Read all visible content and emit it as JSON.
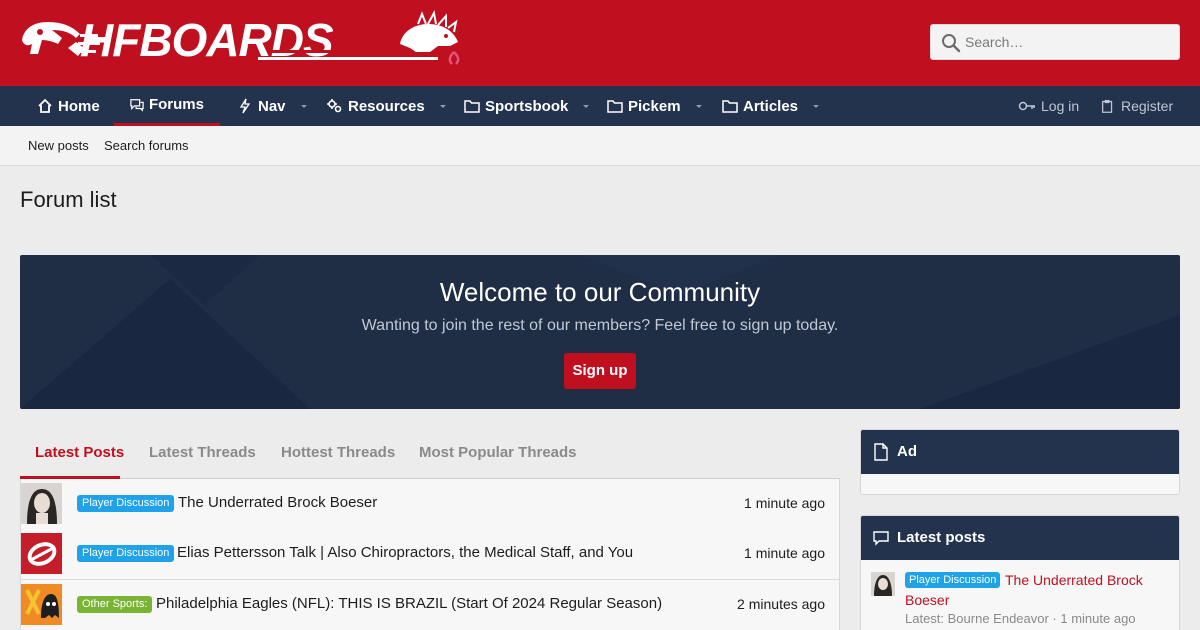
{
  "header": {
    "logo_text": "HFBOARDS",
    "search_placeholder": "Search…"
  },
  "nav": {
    "items": [
      {
        "label": "Home",
        "icon": "home-icon"
      },
      {
        "label": "Forums",
        "icon": "comments-icon",
        "active": true
      },
      {
        "label": "Nav",
        "icon": "bolt-icon",
        "has_dropdown": true
      },
      {
        "label": "Resources",
        "icon": "cogs-icon",
        "has_dropdown": true
      },
      {
        "label": "Sportsbook",
        "icon": "folder-icon",
        "has_dropdown": true
      },
      {
        "label": "Pickem",
        "icon": "folder-icon",
        "has_dropdown": true
      },
      {
        "label": "Articles",
        "icon": "folder-icon",
        "has_dropdown": true
      }
    ],
    "login": "Log in",
    "register": "Register"
  },
  "subnav": {
    "new_posts": "New posts",
    "search_forums": "Search forums"
  },
  "page": {
    "title": "Forum list"
  },
  "welcome": {
    "title": "Welcome to our Community",
    "subtitle": "Wanting to join the rest of our members? Feel free to sign up today.",
    "button": "Sign up"
  },
  "tabs": [
    "Latest Posts",
    "Latest Threads",
    "Hottest Threads",
    "Most Popular Threads"
  ],
  "posts": [
    {
      "label": "Player Discussion",
      "label_color": "blue",
      "title": "The Underrated Brock Boeser",
      "time": "1 minute ago"
    },
    {
      "label": "Player Discussion",
      "label_color": "blue",
      "title": "Elias Pettersson Talk | Also Chiropractors, the Medical Staff, and You",
      "time": "1 minute ago"
    },
    {
      "label": "Other Sports:",
      "label_color": "green",
      "title": "Philadelphia Eagles (NFL): THIS IS BRAZIL (Start Of 2024 Regular Season)",
      "time": "2 minutes ago"
    }
  ],
  "sidebar": {
    "ad_title": "Ad",
    "latest_title": "Latest posts",
    "latest": {
      "label": "Player Discussion",
      "title": "The Underrated Brock Boeser",
      "meta": "Latest: Bourne Endeavor · 1 minute ago"
    }
  },
  "colors": {
    "brand_red": "#c01020",
    "nav_navy": "#23324d",
    "label_blue": "#1fa2e8",
    "label_green": "#79b533"
  }
}
